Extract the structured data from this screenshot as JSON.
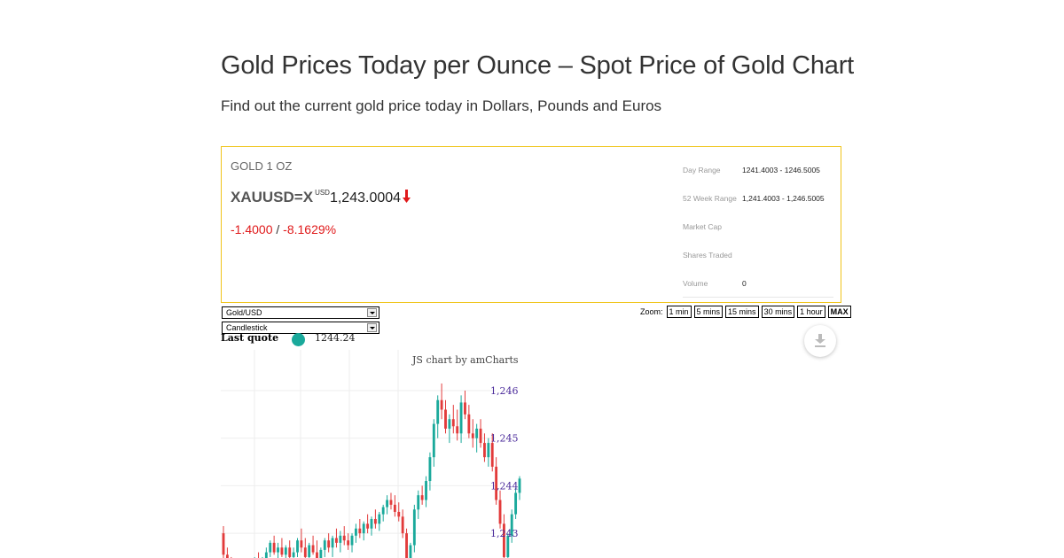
{
  "header": {
    "title": "Gold Prices Today per Ounce – Spot Price of Gold Chart",
    "subtitle": "Find out the current gold price today in Dollars, Pounds and Euros"
  },
  "quote": {
    "instrument": "GOLD 1 OZ",
    "ticker": "XAUUSD=X",
    "currency": "USD",
    "price": "1,243.0004",
    "change": "-1.4000",
    "separator": "/",
    "change_percent": "-8.1629%",
    "direction": "down",
    "stats": [
      {
        "label": "Day Range",
        "value": "1241.4003 - 1246.5005"
      },
      {
        "label": "52 Week Range",
        "value": "1,241.4003 - 1,246.5005"
      },
      {
        "label": "Market Cap",
        "value": ""
      },
      {
        "label": "Shares Traded",
        "value": ""
      },
      {
        "label": "Volume",
        "value": "0"
      }
    ]
  },
  "toolbar": {
    "pair_select": "Gold/USD",
    "chart_type_select": "Candlestick",
    "zoom_label": "Zoom:",
    "zoom_buttons": [
      "1 min",
      "5 mins",
      "15 mins",
      "30 mins",
      "1 hour",
      "MAX"
    ],
    "active_zoom": "MAX"
  },
  "last_quote": {
    "label": "Last quote",
    "value": "1244.24"
  },
  "chart_credit": "JS chart by amCharts",
  "colors": {
    "up": "#1aa99b",
    "down": "#e23b3b",
    "accent_border": "#f0c419",
    "negative": "#e0191a",
    "axis_label": "#4a2a9a"
  },
  "chart_data": {
    "type": "candlestick",
    "y_tick_labels": [
      "1,246",
      "1,245",
      "1,244",
      "1,243"
    ],
    "y_ticks": [
      1246,
      1245,
      1244,
      1243
    ],
    "ylim": [
      1242.2,
      1246.3
    ],
    "grid": true,
    "candles": [
      {
        "o": 1243.0,
        "h": 1243.15,
        "l": 1242.4,
        "c": 1242.55
      },
      {
        "o": 1242.55,
        "h": 1242.7,
        "l": 1242.3,
        "c": 1242.4
      },
      {
        "o": 1242.4,
        "h": 1242.5,
        "l": 1242.25,
        "c": 1242.35
      },
      {
        "o": 1242.35,
        "h": 1242.45,
        "l": 1242.2,
        "c": 1242.3
      },
      {
        "o": 1242.3,
        "h": 1242.4,
        "l": 1242.2,
        "c": 1242.25
      },
      {
        "o": 1242.25,
        "h": 1242.35,
        "l": 1242.2,
        "c": 1242.3
      },
      {
        "o": 1242.3,
        "h": 1242.4,
        "l": 1242.2,
        "c": 1242.25
      },
      {
        "o": 1242.25,
        "h": 1242.35,
        "l": 1242.2,
        "c": 1242.3
      },
      {
        "o": 1242.3,
        "h": 1242.5,
        "l": 1242.2,
        "c": 1242.45
      },
      {
        "o": 1242.45,
        "h": 1242.6,
        "l": 1242.3,
        "c": 1242.35
      },
      {
        "o": 1242.35,
        "h": 1242.5,
        "l": 1242.2,
        "c": 1242.4
      },
      {
        "o": 1242.4,
        "h": 1242.7,
        "l": 1242.3,
        "c": 1242.6
      },
      {
        "o": 1242.6,
        "h": 1242.85,
        "l": 1242.5,
        "c": 1242.8
      },
      {
        "o": 1242.8,
        "h": 1242.95,
        "l": 1242.55,
        "c": 1242.6
      },
      {
        "o": 1242.6,
        "h": 1242.8,
        "l": 1242.45,
        "c": 1242.7
      },
      {
        "o": 1242.7,
        "h": 1242.9,
        "l": 1242.5,
        "c": 1242.55
      },
      {
        "o": 1242.55,
        "h": 1242.75,
        "l": 1242.4,
        "c": 1242.7
      },
      {
        "o": 1242.7,
        "h": 1242.85,
        "l": 1242.45,
        "c": 1242.5
      },
      {
        "o": 1242.5,
        "h": 1242.7,
        "l": 1242.35,
        "c": 1242.6
      },
      {
        "o": 1242.6,
        "h": 1242.9,
        "l": 1242.5,
        "c": 1242.85
      },
      {
        "o": 1242.85,
        "h": 1243.1,
        "l": 1242.6,
        "c": 1242.7
      },
      {
        "o": 1242.7,
        "h": 1242.9,
        "l": 1242.4,
        "c": 1242.5
      },
      {
        "o": 1242.5,
        "h": 1242.8,
        "l": 1242.3,
        "c": 1242.75
      },
      {
        "o": 1242.75,
        "h": 1242.95,
        "l": 1242.55,
        "c": 1242.6
      },
      {
        "o": 1242.6,
        "h": 1242.85,
        "l": 1242.4,
        "c": 1242.45
      },
      {
        "o": 1242.45,
        "h": 1242.7,
        "l": 1242.25,
        "c": 1242.65
      },
      {
        "o": 1242.65,
        "h": 1242.9,
        "l": 1242.5,
        "c": 1242.85
      },
      {
        "o": 1242.85,
        "h": 1243.0,
        "l": 1242.6,
        "c": 1242.7
      },
      {
        "o": 1242.7,
        "h": 1242.95,
        "l": 1242.5,
        "c": 1242.9
      },
      {
        "o": 1242.9,
        "h": 1243.1,
        "l": 1242.7,
        "c": 1242.8
      },
      {
        "o": 1242.8,
        "h": 1243.05,
        "l": 1242.6,
        "c": 1242.95
      },
      {
        "o": 1242.95,
        "h": 1243.15,
        "l": 1242.75,
        "c": 1242.85
      },
      {
        "o": 1242.85,
        "h": 1243.0,
        "l": 1242.65,
        "c": 1242.75
      },
      {
        "o": 1242.75,
        "h": 1243.0,
        "l": 1242.6,
        "c": 1242.95
      },
      {
        "o": 1242.95,
        "h": 1243.2,
        "l": 1242.8,
        "c": 1243.1
      },
      {
        "o": 1243.1,
        "h": 1243.3,
        "l": 1242.9,
        "c": 1243.0
      },
      {
        "o": 1243.0,
        "h": 1243.25,
        "l": 1242.85,
        "c": 1243.2
      },
      {
        "o": 1243.2,
        "h": 1243.4,
        "l": 1243.0,
        "c": 1243.1
      },
      {
        "o": 1243.1,
        "h": 1243.35,
        "l": 1242.95,
        "c": 1243.3
      },
      {
        "o": 1243.3,
        "h": 1243.5,
        "l": 1243.1,
        "c": 1243.2
      },
      {
        "o": 1243.2,
        "h": 1243.45,
        "l": 1243.05,
        "c": 1243.4
      },
      {
        "o": 1243.4,
        "h": 1243.6,
        "l": 1243.25,
        "c": 1243.55
      },
      {
        "o": 1243.55,
        "h": 1243.8,
        "l": 1243.4,
        "c": 1243.7
      },
      {
        "o": 1243.7,
        "h": 1243.85,
        "l": 1243.5,
        "c": 1243.6
      },
      {
        "o": 1243.6,
        "h": 1243.8,
        "l": 1243.35,
        "c": 1243.45
      },
      {
        "o": 1243.45,
        "h": 1243.65,
        "l": 1243.25,
        "c": 1243.35
      },
      {
        "o": 1243.35,
        "h": 1243.5,
        "l": 1242.9,
        "c": 1243.0
      },
      {
        "o": 1243.0,
        "h": 1243.1,
        "l": 1242.25,
        "c": 1242.4
      },
      {
        "o": 1242.4,
        "h": 1242.8,
        "l": 1242.3,
        "c": 1242.75
      },
      {
        "o": 1242.75,
        "h": 1243.6,
        "l": 1242.6,
        "c": 1243.5
      },
      {
        "o": 1243.5,
        "h": 1243.9,
        "l": 1243.3,
        "c": 1243.8
      },
      {
        "o": 1243.8,
        "h": 1244.0,
        "l": 1243.6,
        "c": 1243.7
      },
      {
        "o": 1243.7,
        "h": 1244.2,
        "l": 1243.55,
        "c": 1244.1
      },
      {
        "o": 1244.1,
        "h": 1244.7,
        "l": 1243.9,
        "c": 1244.6
      },
      {
        "o": 1244.6,
        "h": 1245.4,
        "l": 1244.4,
        "c": 1245.3
      },
      {
        "o": 1245.3,
        "h": 1245.9,
        "l": 1245.0,
        "c": 1245.8
      },
      {
        "o": 1245.8,
        "h": 1246.15,
        "l": 1245.4,
        "c": 1245.6
      },
      {
        "o": 1245.6,
        "h": 1245.8,
        "l": 1245.1,
        "c": 1245.2
      },
      {
        "o": 1245.2,
        "h": 1245.5,
        "l": 1244.9,
        "c": 1245.4
      },
      {
        "o": 1245.4,
        "h": 1245.7,
        "l": 1245.1,
        "c": 1245.25
      },
      {
        "o": 1245.25,
        "h": 1245.6,
        "l": 1244.95,
        "c": 1245.1
      },
      {
        "o": 1245.1,
        "h": 1245.9,
        "l": 1244.9,
        "c": 1245.75
      },
      {
        "o": 1245.75,
        "h": 1246.0,
        "l": 1245.4,
        "c": 1245.5
      },
      {
        "o": 1245.5,
        "h": 1245.7,
        "l": 1245.0,
        "c": 1245.1
      },
      {
        "o": 1245.1,
        "h": 1245.4,
        "l": 1244.8,
        "c": 1245.0
      },
      {
        "o": 1245.0,
        "h": 1245.3,
        "l": 1244.7,
        "c": 1245.2
      },
      {
        "o": 1245.2,
        "h": 1245.4,
        "l": 1244.8,
        "c": 1244.9
      },
      {
        "o": 1244.9,
        "h": 1245.1,
        "l": 1244.5,
        "c": 1244.6
      },
      {
        "o": 1244.6,
        "h": 1245.0,
        "l": 1244.4,
        "c": 1244.9
      },
      {
        "o": 1244.9,
        "h": 1245.1,
        "l": 1244.3,
        "c": 1244.4
      },
      {
        "o": 1244.4,
        "h": 1244.6,
        "l": 1243.6,
        "c": 1243.7
      },
      {
        "o": 1243.7,
        "h": 1243.9,
        "l": 1243.1,
        "c": 1243.2
      },
      {
        "o": 1243.2,
        "h": 1243.4,
        "l": 1242.3,
        "c": 1242.5
      },
      {
        "o": 1242.5,
        "h": 1243.0,
        "l": 1242.35,
        "c": 1242.95
      },
      {
        "o": 1242.95,
        "h": 1243.5,
        "l": 1242.8,
        "c": 1243.4
      },
      {
        "o": 1243.4,
        "h": 1243.95,
        "l": 1243.3,
        "c": 1243.85
      },
      {
        "o": 1243.85,
        "h": 1244.2,
        "l": 1243.7,
        "c": 1244.15
      }
    ]
  }
}
